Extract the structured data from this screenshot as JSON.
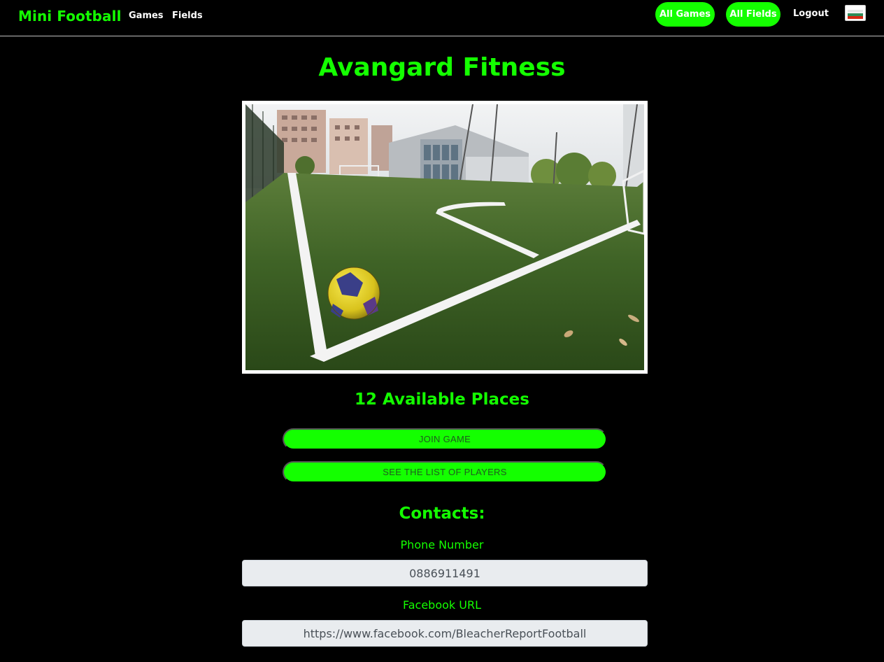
{
  "navbar": {
    "brand": "Mini Football",
    "links": {
      "games": "Games",
      "fields": "Fields"
    },
    "pills": {
      "all_games": "All Games",
      "all_fields": "All Fields"
    },
    "logout": "Logout",
    "language_flag_icon": "flag-icon"
  },
  "field": {
    "name": "Avangard Fitness",
    "image_alt": "football-field-photo",
    "available_places": "12 Available Places"
  },
  "actions": {
    "join": "JOIN GAME",
    "players": "SEE THE LIST OF PLAYERS"
  },
  "contacts": {
    "heading": "Contacts:",
    "phone_label": "Phone Number",
    "phone_value": "0886911491",
    "facebook_label": "Facebook URL",
    "facebook_value": "https://www.facebook.com/BleacherReportFootball"
  },
  "colors": {
    "accent": "#14ff00",
    "background": "#000000",
    "input_bg": "#e9ecef"
  }
}
